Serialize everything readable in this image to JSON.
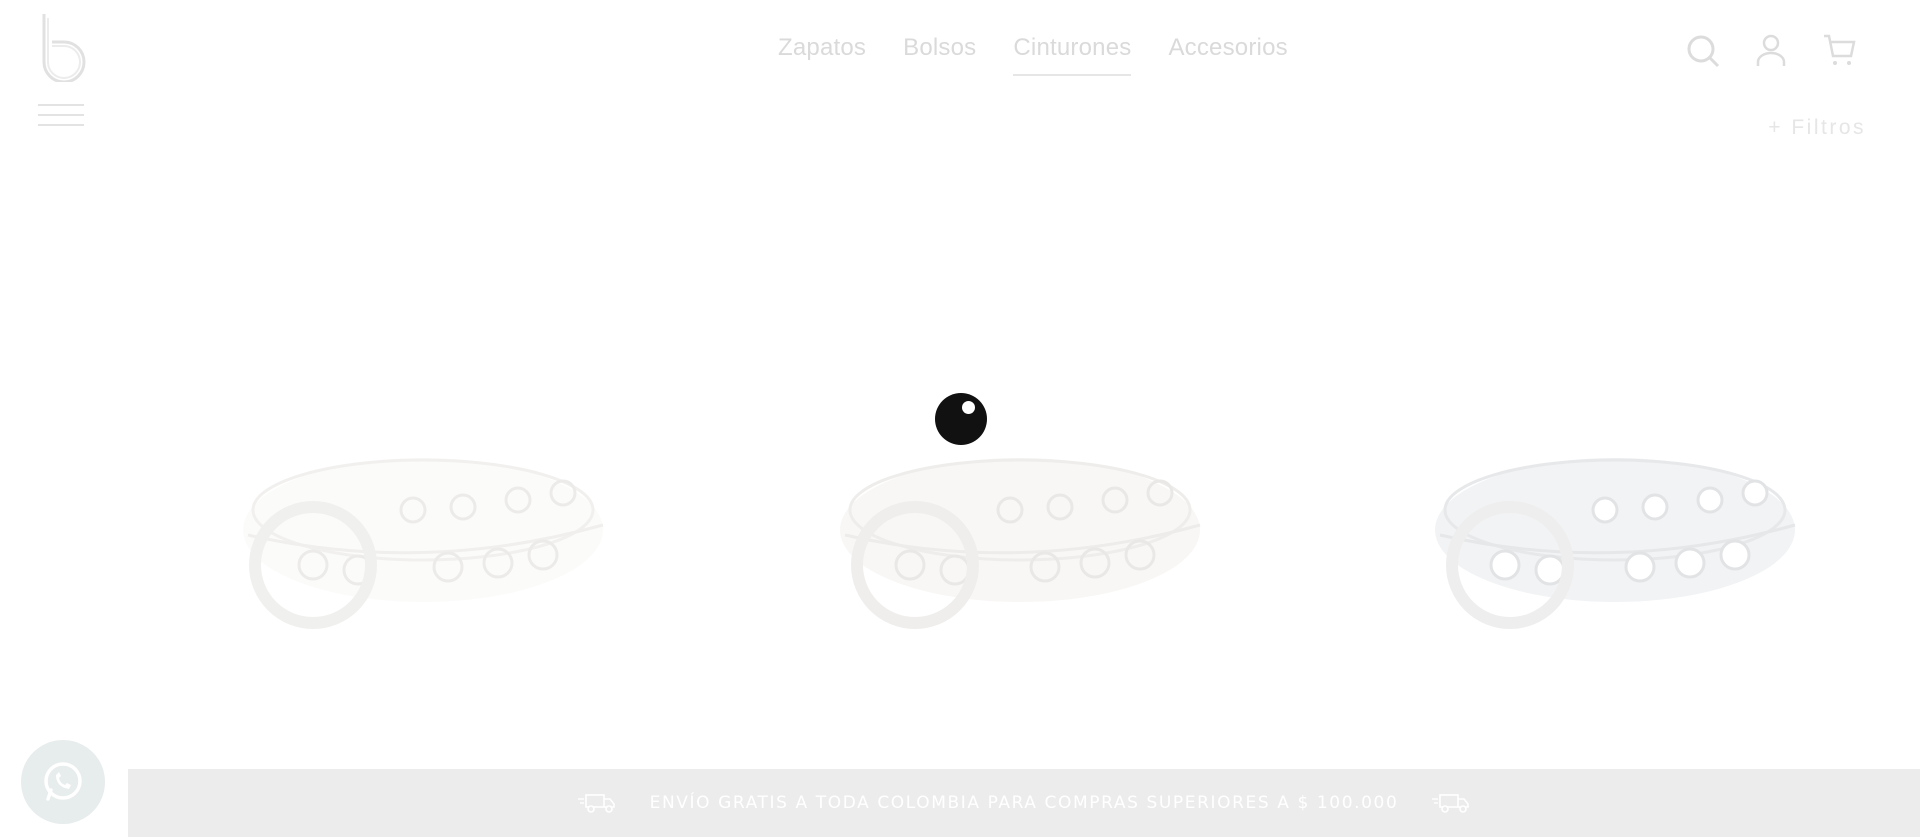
{
  "header": {
    "logo_letter": "b",
    "nav": [
      {
        "label": "Zapatos",
        "active": false
      },
      {
        "label": "Bolsos",
        "active": false
      },
      {
        "label": "Cinturones",
        "active": true
      },
      {
        "label": "Accesorios",
        "active": false
      }
    ],
    "icons": [
      "search-icon",
      "user-icon",
      "cart-icon"
    ]
  },
  "filters": {
    "label": "+ Filtros"
  },
  "products": [
    {
      "name": "product-belt-1",
      "color": "#fafaf8"
    },
    {
      "name": "product-belt-2",
      "color": "#f6f5f2"
    },
    {
      "name": "product-belt-3",
      "color": "#f1f2f3"
    }
  ],
  "promo": {
    "text": "ENVÍO GRATIS A TODA COLOMBIA PARA COMPRAS SUPERIORES A $ 100.000"
  },
  "colors": {
    "promo_bg": "#ececec",
    "loader": "#111111",
    "whatsapp_bg": "#e7ecec"
  }
}
